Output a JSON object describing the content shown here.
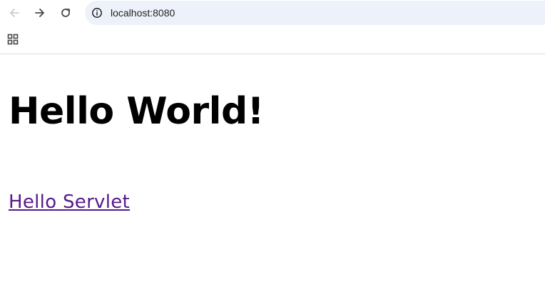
{
  "browser": {
    "address_bar": {
      "url": "localhost:8080"
    },
    "icons": {
      "back": "arrow-left-icon",
      "forward": "arrow-right-icon",
      "reload": "reload-icon",
      "site_info": "info-icon",
      "apps": "apps-grid-icon"
    }
  },
  "page": {
    "heading": "Hello World!",
    "link_label": "Hello Servlet"
  },
  "colors": {
    "visited_link": "#551a8b",
    "omnibox_background": "#edf2fa",
    "disabled_icon": "#c4c7c5",
    "active_icon": "#474747"
  }
}
